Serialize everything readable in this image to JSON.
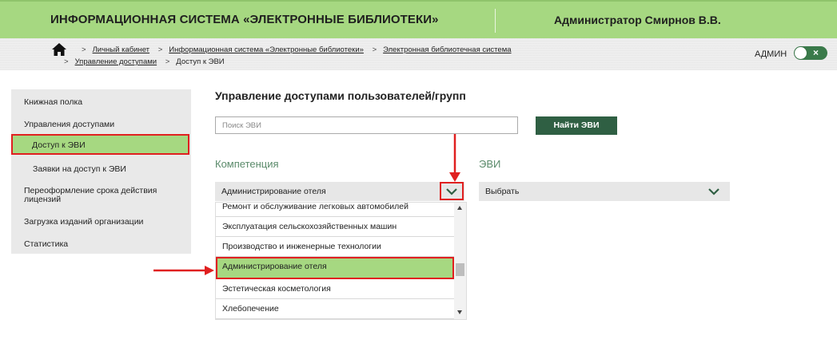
{
  "header": {
    "system_title": "ИНФОРМАЦИОННАЯ СИСТЕМА «ЭЛЕКТРОННЫЕ БИБЛИОТЕКИ»",
    "user": "Администратор Смирнов В.В."
  },
  "breadcrumbs": {
    "items": [
      "Личный кабинет",
      "Информационная система «Электронные библиотеки»",
      "Электронная библиотечная система",
      "Управление доступами",
      "Доступ к ЭВИ"
    ],
    "separator": ">"
  },
  "admin": {
    "label": "АДМИН",
    "toggle_icon": "×"
  },
  "sidebar": {
    "items": [
      "Книжная полка",
      "Управления доступами",
      "Доступ к ЭВИ",
      "Заявки на доступ к ЭВИ",
      "Переоформление срока действия лицензий",
      "Загрузка изданий организации",
      "Статистика"
    ],
    "active_index": 2
  },
  "main": {
    "title": "Управление доступами пользователей/групп",
    "search_placeholder": "Поиск ЭВИ",
    "search_button": "Найти ЭВИ",
    "competence_label": "Компетенция",
    "evi_label": "ЭВИ",
    "competence_value": "Администрирование отеля",
    "evi_value": "Выбрать",
    "options": [
      "Ремонт и обслуживание легковых автомобилей",
      "Эксплуатация сельскохозяйственных машин",
      "Производство и инженерные технологии",
      "Администрирование отеля",
      "Эстетическая косметология",
      "Хлебопечение"
    ],
    "selected_option_index": 3
  },
  "colors": {
    "accent_green": "#a6d881",
    "dark_green": "#2f5f43",
    "highlight_red": "#e02020"
  }
}
